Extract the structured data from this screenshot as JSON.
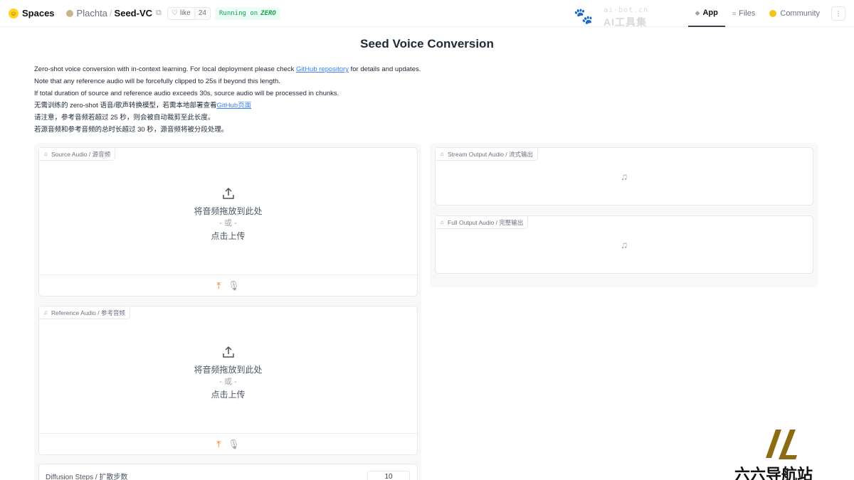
{
  "nav": {
    "spaces_label": "Spaces",
    "owner": "Plachta",
    "separator": "/",
    "repo": "Seed-VC",
    "like_label": "like",
    "like_count": "24",
    "status_prefix": "Running on",
    "status_hw": "ZERO",
    "tabs": [
      {
        "label": "App",
        "active": true
      },
      {
        "label": "Files",
        "active": false
      },
      {
        "label": "Community",
        "active": false
      }
    ]
  },
  "watermark": {
    "line1": "ai-bot.cn",
    "line2": "AI工具集"
  },
  "page": {
    "title": "Seed Voice Conversion",
    "desc": {
      "line1_pre": "Zero-shot voice conversion with in-context learning. For local deployment please check ",
      "line1_link": "GitHub repository",
      "line1_post": " for details and updates.",
      "line2": "Note that any reference audio will be forcefully clipped to 25s if beyond this length.",
      "line3": "If total duration of source and reference audio exceeds 30s, source audio will be processed in chunks.",
      "line4_pre": "无需训练的 zero-shot 语音/歌声转换模型，若需本地部署查看",
      "line4_link": "GitHub页面",
      "line5": "请注意，参考音频若超过 25 秒，则会被自动裁剪至此长度。",
      "line6": "若源音频和参考音频的总时长超过 30 秒，源音频将被分段处理。"
    }
  },
  "source_audio": {
    "label": "Source Audio / 源音频",
    "drop_text": "将音频拖放到此处",
    "or_text": "- 或 -",
    "click_text": "点击上传"
  },
  "reference_audio": {
    "label": "Reference Audio / 参考音频",
    "drop_text": "将音频拖放到此处",
    "or_text": "- 或 -",
    "click_text": "点击上传"
  },
  "stream_output": {
    "label": "Stream Output Audio / 流式输出"
  },
  "full_output": {
    "label": "Full Output Audio / 完整输出"
  },
  "diffusion": {
    "label": "Diffusion Steps / 扩散步数",
    "value": "10"
  },
  "corner_logo": {
    "text": "六六导航站"
  },
  "colors": {
    "accent_orange": "#f97316",
    "running_green": "#16a34a",
    "link_blue": "#3b82f6"
  }
}
